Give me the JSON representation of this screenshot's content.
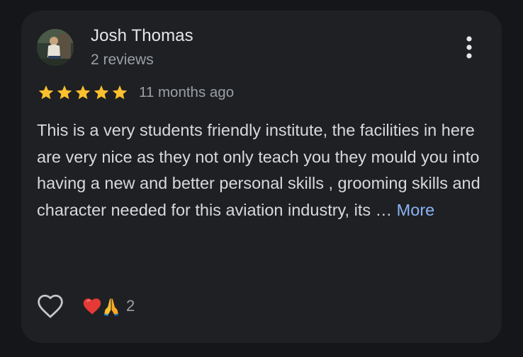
{
  "review": {
    "reviewer_name": "Josh Thomas",
    "review_count": "2 reviews",
    "rating": 5,
    "max_rating": 5,
    "time_ago": "11 months ago",
    "text": "This is a very students friendly institute, the facilities in here are very nice as they not only teach you they mould you into having a new and better personal skills , grooming skills and character needed for this aviation industry, its … ",
    "more_label": "More"
  },
  "reactions": {
    "emojis": [
      "heart",
      "folded-hands"
    ],
    "count": "2"
  },
  "icons": {
    "menu": "more-vert-icon",
    "like": "heart-outline-icon",
    "star": "star-icon"
  },
  "colors": {
    "background": "#151619",
    "card": "#1f2023",
    "star": "#fbc02d",
    "link": "#8ab4f8",
    "primary_text": "#e4e6e9",
    "secondary_text": "#9ba0a6"
  }
}
